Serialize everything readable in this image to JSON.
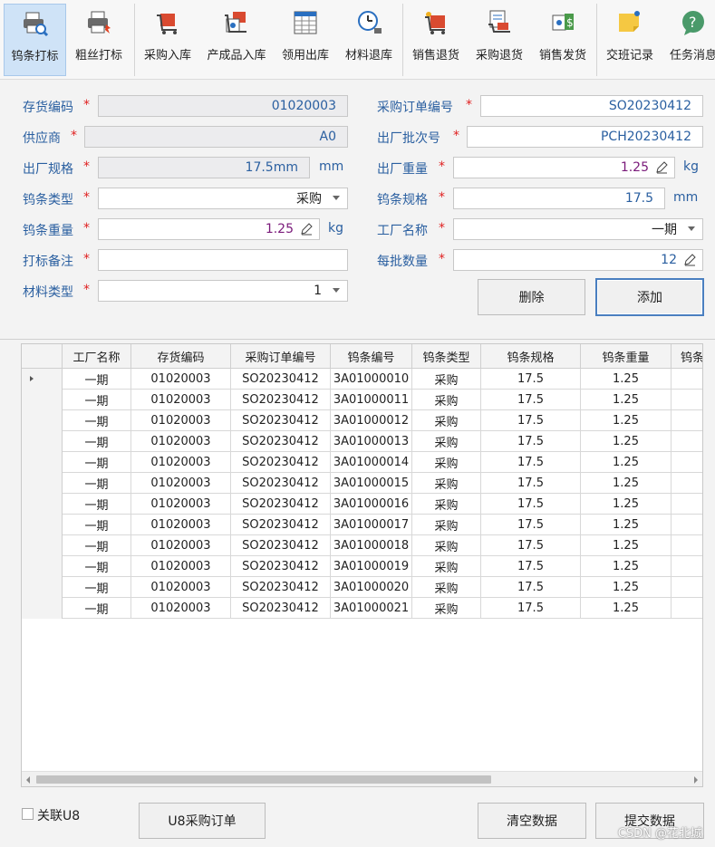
{
  "toolbar": {
    "buttons": [
      {
        "label": "钨条打标",
        "icon": "search-printer-icon"
      },
      {
        "label": "粗丝打标",
        "icon": "printer-icon"
      },
      {
        "label": "采购入库",
        "icon": "cart-in-icon"
      },
      {
        "label": "产成品入库",
        "icon": "product-in-icon"
      },
      {
        "label": "领用出库",
        "icon": "grid-sheet-icon"
      },
      {
        "label": "材料退库",
        "icon": "clock-return-icon"
      },
      {
        "label": "销售退货",
        "icon": "sale-return-icon"
      },
      {
        "label": "采购退货",
        "icon": "purchase-return-icon"
      },
      {
        "label": "销售发货",
        "icon": "dollar-tag-icon"
      },
      {
        "label": "交班记录",
        "icon": "sticky-note-icon"
      },
      {
        "label": "任务消息",
        "icon": "help-bubble-icon"
      }
    ]
  },
  "form": {
    "inventory_code": {
      "label": "存货编码",
      "value": "01020003"
    },
    "po_number": {
      "label": "采购订单编号",
      "value": "SO20230412"
    },
    "supplier": {
      "label": "供应商",
      "value": "A0"
    },
    "factory_batch": {
      "label": "出厂批次号",
      "value": "PCH20230412"
    },
    "factory_spec": {
      "label": "出厂规格",
      "value": "17.5mm",
      "unit": "mm"
    },
    "factory_weight": {
      "label": "出厂重量",
      "value": "1.25",
      "unit": "kg"
    },
    "bar_type": {
      "label": "钨条类型",
      "value": "采购"
    },
    "bar_spec": {
      "label": "钨条规格",
      "value": "17.5",
      "unit": "mm"
    },
    "bar_weight": {
      "label": "钨条重量",
      "value": "1.25",
      "unit": "kg"
    },
    "factory_name": {
      "label": "工厂名称",
      "value": "一期"
    },
    "marking_note": {
      "label": "打标备注",
      "value": ""
    },
    "batch_qty": {
      "label": "每批数量",
      "value": "12"
    },
    "material_type": {
      "label": "材料类型",
      "value": "1"
    },
    "required_mark": "*"
  },
  "actions": {
    "delete": "删除",
    "add": "添加",
    "u8_po": "U8采购订单",
    "clear": "清空数据",
    "submit": "提交数据",
    "link_u8": "关联U8"
  },
  "grid": {
    "columns": [
      "工厂名称",
      "存货编码",
      "采购订单编号",
      "钨条编号",
      "钨条类型",
      "钨条规格",
      "钨条重量",
      "钨条"
    ],
    "rows": [
      [
        "一期",
        "01020003",
        "SO20230412",
        "3A01000010",
        "采购",
        "17.5",
        "1.25"
      ],
      [
        "一期",
        "01020003",
        "SO20230412",
        "3A01000011",
        "采购",
        "17.5",
        "1.25"
      ],
      [
        "一期",
        "01020003",
        "SO20230412",
        "3A01000012",
        "采购",
        "17.5",
        "1.25"
      ],
      [
        "一期",
        "01020003",
        "SO20230412",
        "3A01000013",
        "采购",
        "17.5",
        "1.25"
      ],
      [
        "一期",
        "01020003",
        "SO20230412",
        "3A01000014",
        "采购",
        "17.5",
        "1.25"
      ],
      [
        "一期",
        "01020003",
        "SO20230412",
        "3A01000015",
        "采购",
        "17.5",
        "1.25"
      ],
      [
        "一期",
        "01020003",
        "SO20230412",
        "3A01000016",
        "采购",
        "17.5",
        "1.25"
      ],
      [
        "一期",
        "01020003",
        "SO20230412",
        "3A01000017",
        "采购",
        "17.5",
        "1.25"
      ],
      [
        "一期",
        "01020003",
        "SO20230412",
        "3A01000018",
        "采购",
        "17.5",
        "1.25"
      ],
      [
        "一期",
        "01020003",
        "SO20230412",
        "3A01000019",
        "采购",
        "17.5",
        "1.25"
      ],
      [
        "一期",
        "01020003",
        "SO20230412",
        "3A01000020",
        "采购",
        "17.5",
        "1.25"
      ],
      [
        "一期",
        "01020003",
        "SO20230412",
        "3A01000021",
        "采购",
        "17.5",
        "1.25"
      ]
    ]
  },
  "watermark": "CSDN @花北城",
  "colors": {
    "label_blue": "#2a5fa0",
    "required_red": "#e02020",
    "active_tab": "#cfe3f7"
  }
}
